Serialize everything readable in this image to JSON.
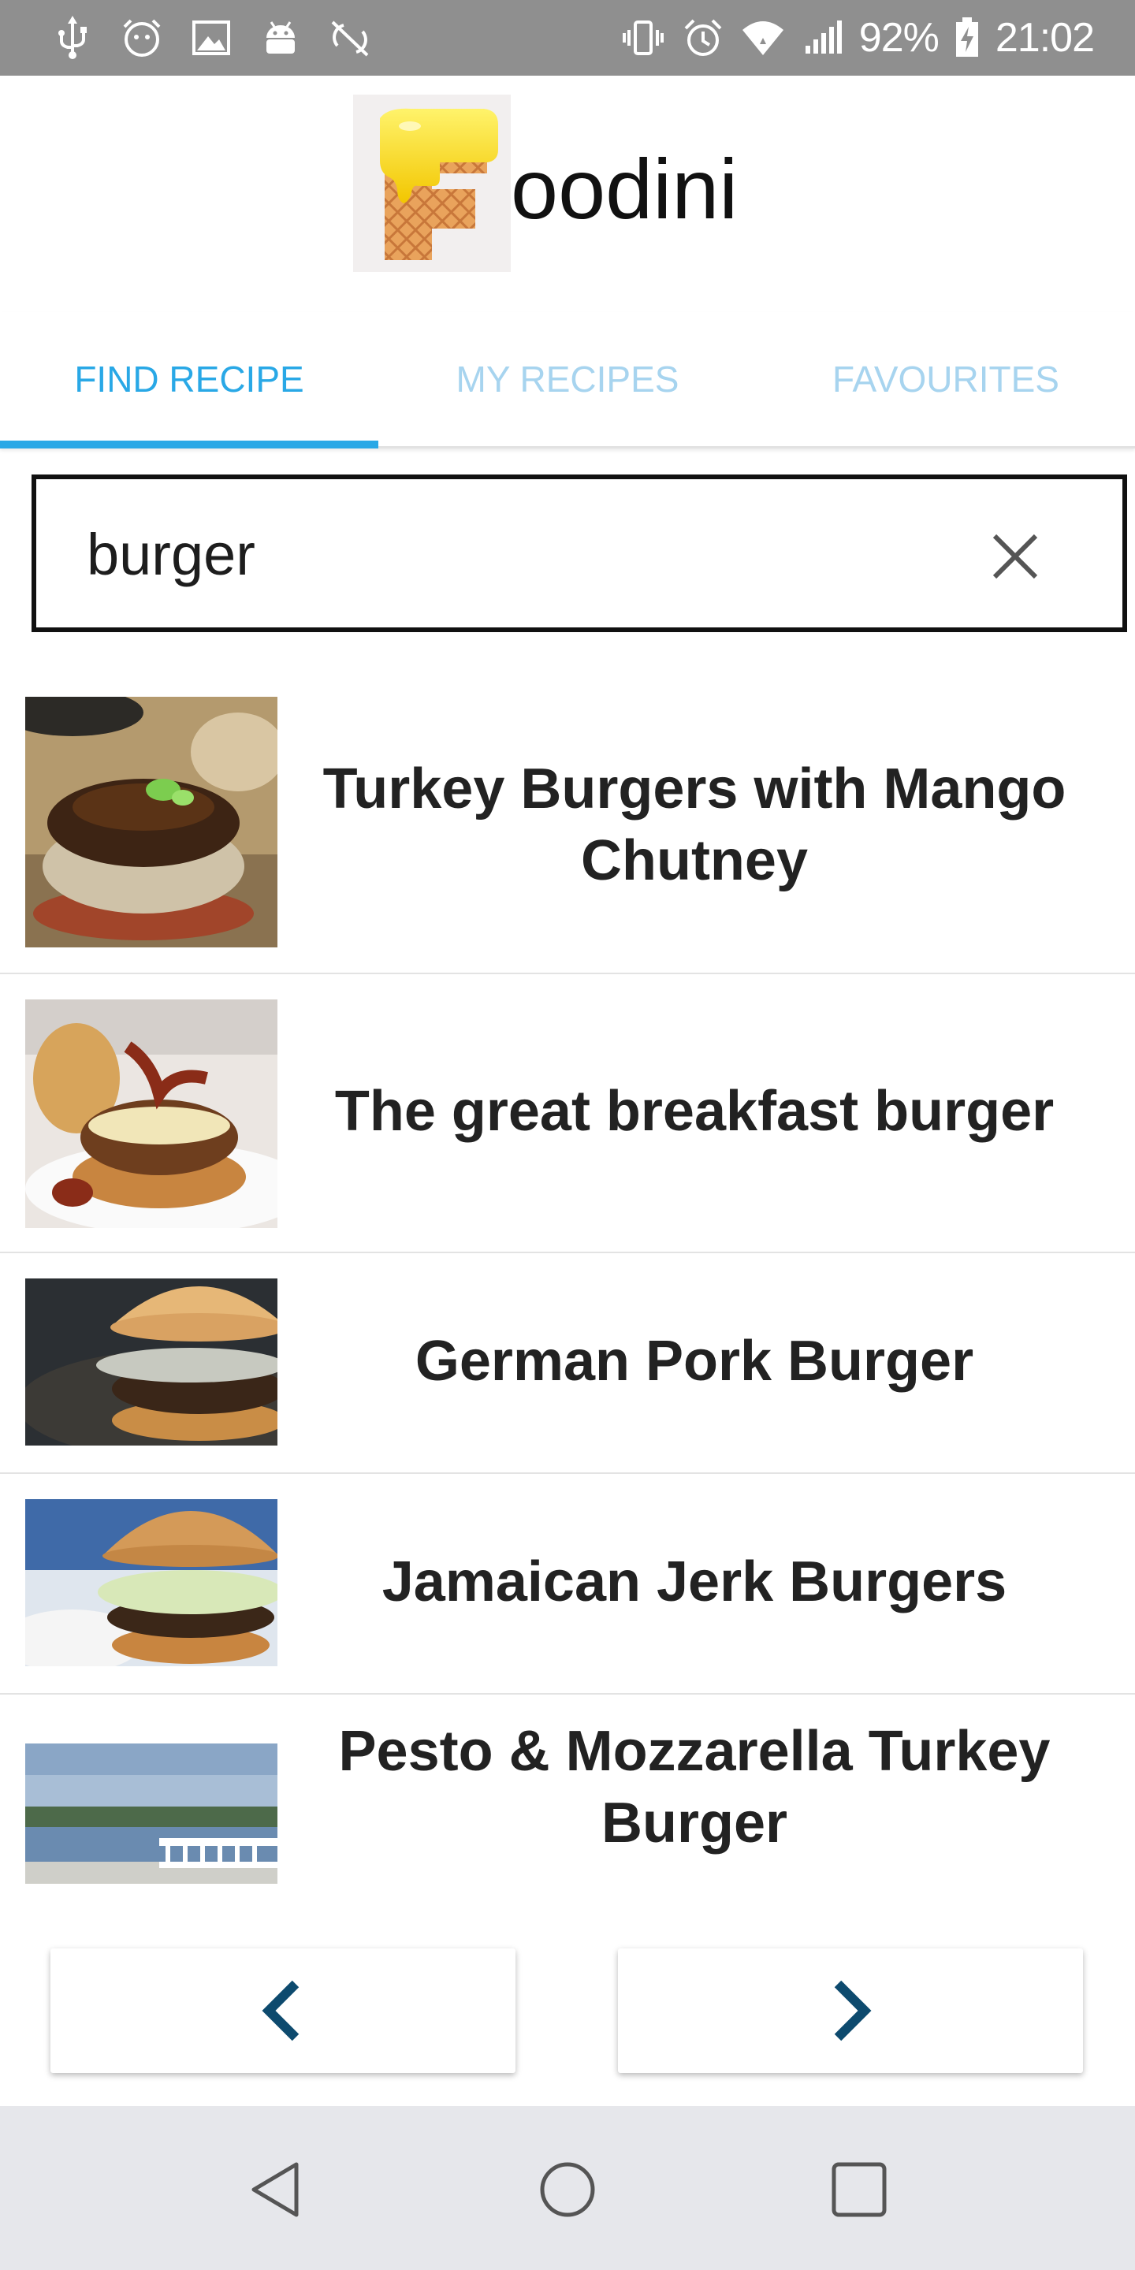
{
  "status_bar": {
    "battery": "92%",
    "time": "21:02",
    "left_icons": [
      "usb-icon",
      "face-icon",
      "image-icon",
      "android-icon",
      "sync-off-icon"
    ],
    "right_icons": [
      "vibrate-icon",
      "alarm-icon",
      "wifi-icon",
      "signal-icon",
      "battery-charging-icon"
    ]
  },
  "header": {
    "logo_icon": "waffle-f-logo-icon",
    "app_name_suffix": "oodini"
  },
  "tabs": [
    {
      "label": "FIND RECIPE",
      "active": true
    },
    {
      "label": "MY RECIPES",
      "active": false
    },
    {
      "label": "FAVOURITES",
      "active": false
    }
  ],
  "search": {
    "value": "burger",
    "clear_icon": "close-icon"
  },
  "results": [
    {
      "title": "Turkey Burgers with Mango Chutney"
    },
    {
      "title": "The great breakfast burger"
    },
    {
      "title": "German Pork Burger"
    },
    {
      "title": "Jamaican Jerk Burgers"
    },
    {
      "title": "Pesto & Mozzarella Turkey Burger"
    }
  ],
  "pager": {
    "prev_icon": "chevron-left-icon",
    "next_icon": "chevron-right-icon"
  },
  "navigation_bar": [
    "back-icon",
    "home-icon",
    "recents-icon"
  ],
  "colors": {
    "accent": "#29a8e6",
    "tab_inactive": "#a7d4ef",
    "pager_arrow": "#0d4a6e",
    "status_bar": "#8f8f8f"
  }
}
